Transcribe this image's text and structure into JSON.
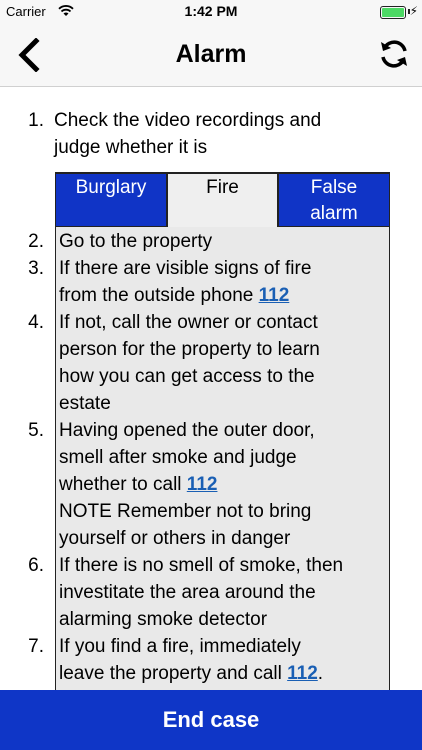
{
  "status_bar": {
    "carrier": "Carrier",
    "time": "1:42 PM"
  },
  "nav": {
    "title": "Alarm",
    "back_icon": "chevron-left-icon",
    "refresh_icon": "refresh-icon"
  },
  "steps": {
    "intro_num": "1.",
    "intro_line1": "Check the video recordings and",
    "intro_line2": "judge whether it is",
    "tabs": {
      "burglary": "Burglary",
      "fire": "Fire",
      "false_line1": "False",
      "false_line2": "alarm",
      "active": "Fire"
    },
    "s2": {
      "num": "2.",
      "l1": "Go to the property"
    },
    "s3": {
      "num": "3.",
      "l1": "If there are visible signs of fire",
      "l2": "from the outside phone ",
      "link": "112"
    },
    "s4": {
      "num": "4.",
      "l1": "If not, call the owner or contact",
      "l2": "person for the property to learn",
      "l3": "how you can get access to the",
      "l4": "estate"
    },
    "s5": {
      "num": "5.",
      "l1": "Having opened the outer door,",
      "l2": "smell after smoke and judge",
      "l3": "whether to call ",
      "link": "112",
      "l4": "NOTE Remember not to bring",
      "l5": "yourself or others in danger"
    },
    "s6": {
      "num": "6.",
      "l1": "If there is no smell of smoke, then",
      "l2": "investitate the area around the",
      "l3": "alarming smoke detector"
    },
    "s7": {
      "num": "7.",
      "l1": "If you find a fire, immediately",
      "l2": "leave the property and call ",
      "link": "112",
      "l2_end": "."
    }
  },
  "footer": {
    "end_case_label": "End case"
  },
  "colors": {
    "primary_blue": "#0f36c7",
    "tab_blue": "#1034c6",
    "link": "#1a5fb4",
    "battery": "#4cd964"
  }
}
